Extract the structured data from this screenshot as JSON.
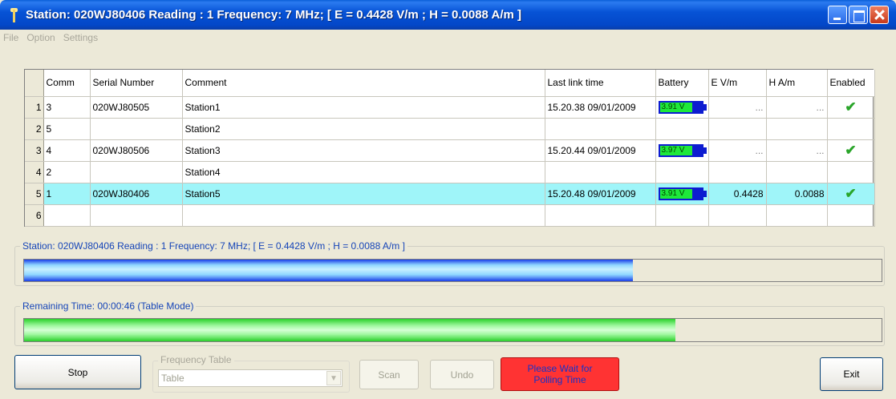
{
  "window": {
    "title": "Station: 020WJ80406 Reading : 1 Frequency: 7 MHz; [ E = 0.4428  V/m ; H = 0.0088  A/m ]"
  },
  "menu": [
    "File",
    "Option",
    "Settings"
  ],
  "table": {
    "headers": [
      "",
      "Comm",
      "Serial Number",
      "Comment",
      "Last link time",
      "Battery",
      "E V/m",
      "H A/m",
      "Enabled"
    ],
    "rows": [
      {
        "idx": "1",
        "comm": "3",
        "serial": "020WJ80505",
        "comment": "Station1",
        "last_link": "15.20.38 09/01/2009",
        "battery": "3.91 V",
        "e": "...",
        "h": "...",
        "enabled": "✔"
      },
      {
        "idx": "2",
        "comm": "5",
        "serial": "",
        "comment": "Station2",
        "last_link": "",
        "battery": "",
        "e": "",
        "h": "",
        "enabled": ""
      },
      {
        "idx": "3",
        "comm": "4",
        "serial": "020WJ80506",
        "comment": "Station3",
        "last_link": "15.20.44 09/01/2009",
        "battery": "3.97 V",
        "e": "...",
        "h": "...",
        "enabled": "✔"
      },
      {
        "idx": "4",
        "comm": "2",
        "serial": "",
        "comment": "Station4",
        "last_link": "",
        "battery": "",
        "e": "",
        "h": "",
        "enabled": ""
      },
      {
        "idx": "5",
        "comm": "1",
        "serial": "020WJ80406",
        "comment": "Station5",
        "last_link": "15.20.48 09/01/2009",
        "battery": "3.91 V",
        "e": "0.4428",
        "h": "0.0088",
        "enabled": "✔"
      },
      {
        "idx": "6",
        "comm": "",
        "serial": "",
        "comment": "",
        "last_link": "",
        "battery": "",
        "e": "",
        "h": "",
        "enabled": ""
      }
    ],
    "selected_row": 4
  },
  "reading_group": {
    "label": "Station: 020WJ80406 Reading : 1 Frequency: 7 MHz; [ E = 0.4428  V/m ; H = 0.0088  A/m ]",
    "progress": 0.71
  },
  "time_group": {
    "label": "Remaining Time: 00:00:46 (Table Mode)",
    "progress": 0.76
  },
  "buttons": {
    "stop": "Stop",
    "scan": "Scan",
    "undo": "Undo",
    "wait": "Please Wait for Polling Time",
    "exit": "Exit"
  },
  "frequency_table": {
    "label": "Frequency Table",
    "value": "Table"
  },
  "colors": {
    "selected_row": "#9ff5f9",
    "wait_button": "#ff3333",
    "title_bar": "#0753d6"
  }
}
